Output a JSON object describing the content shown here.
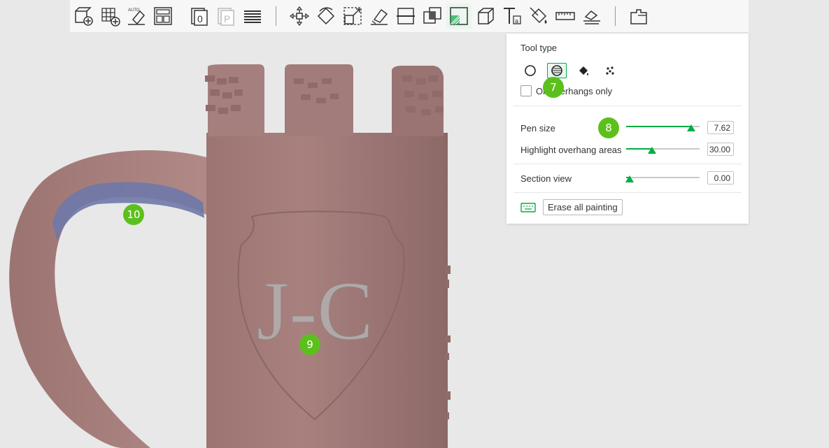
{
  "toolbar": {
    "icons": [
      "add-plate-icon",
      "grid-arrange-icon",
      "auto-orient-icon",
      "arrange-icon",
      "layer-0-icon",
      "layer-p-icon",
      "layers-list-icon",
      "move-icon",
      "rotate-icon",
      "scale-icon",
      "lay-on-face-icon",
      "cut-icon",
      "boolean-icon",
      "support-paint-icon",
      "measure-cube-icon",
      "text-tool-icon",
      "color-paint-icon",
      "ruler-icon",
      "assembly-icon",
      "split-parts-icon"
    ]
  },
  "panel": {
    "tool_type_label": "Tool type",
    "tools": [
      "circle-tool",
      "sphere-tool",
      "fill-tool",
      "gap-fill-tool"
    ],
    "overhangs_only_label": "On overhangs only",
    "pen_size_label": "Pen size",
    "pen_size_value": "7.62",
    "pen_size_fraction": 0.89,
    "highlight_label": "Highlight overhang areas",
    "highlight_value": "30.00",
    "highlight_fraction": 0.35,
    "section_label": "Section view",
    "section_value": "0.00",
    "section_fraction": 0.05,
    "erase_label": "Erase all painting"
  },
  "model": {
    "engraving": "J-C"
  },
  "badges": {
    "b7": "7",
    "b8": "8",
    "b9": "9",
    "b10": "10"
  },
  "colors": {
    "accent": "#00ae42",
    "model": "#a47c7c",
    "paint": "#6f78a8",
    "badge": "#5cc01c"
  }
}
